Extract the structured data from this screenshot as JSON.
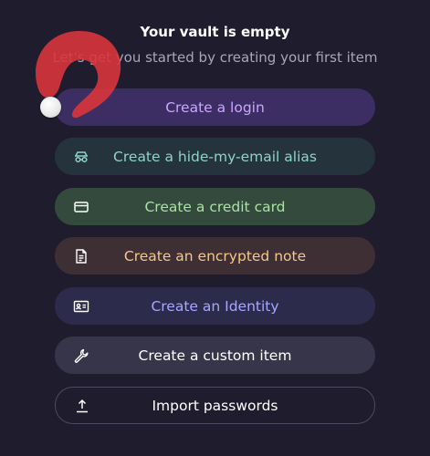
{
  "empty_state": {
    "title": "Your vault is empty",
    "subtitle": "Let's get you started by creating your first item"
  },
  "actions": [
    {
      "label": "Create a login",
      "icon": "login-icon",
      "color": "#c9a6ff"
    },
    {
      "label": "Create a hide-my-email alias",
      "icon": "alias-icon",
      "color": "#8fd3c6"
    },
    {
      "label": "Create a credit card",
      "icon": "credit-card-icon",
      "color": "#a8e3a4"
    },
    {
      "label": "Create an encrypted note",
      "icon": "note-icon",
      "color": "#f7c68c"
    },
    {
      "label": "Create an Identity",
      "icon": "identity-icon",
      "color": "#a9a6ff"
    },
    {
      "label": "Create a custom item",
      "icon": "wrench-icon",
      "color": "#ffffff"
    },
    {
      "label": "Import passwords",
      "icon": "upload-icon",
      "color": "#ffffff"
    }
  ]
}
